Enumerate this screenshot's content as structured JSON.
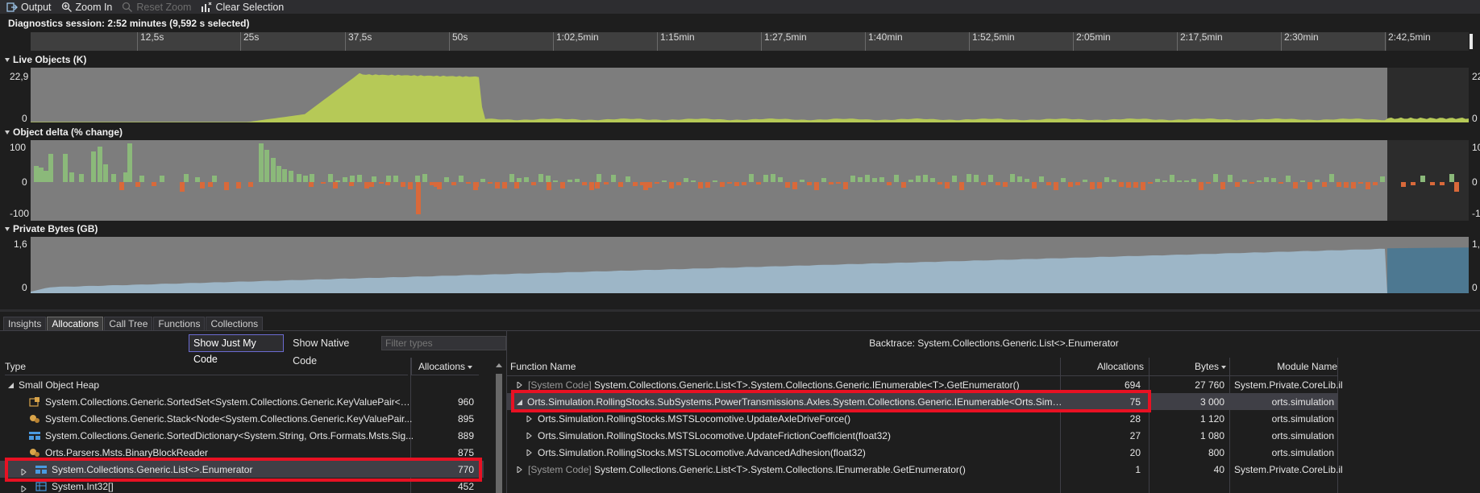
{
  "toolbar": {
    "output": "Output",
    "zoom_in": "Zoom In",
    "reset_zoom": "Reset Zoom",
    "clear_selection": "Clear Selection"
  },
  "session": {
    "label": "Diagnostics session:",
    "value": "2:52 minutes (9,592 s selected)"
  },
  "ruler": {
    "ticks": [
      "12,5s",
      "25s",
      "37,5s",
      "50s",
      "1:02,5min",
      "1:15min",
      "1:27,5min",
      "1:40min",
      "1:52,5min",
      "2:05min",
      "2:17,5min",
      "2:30min",
      "2:42,5min"
    ]
  },
  "graphs": {
    "live_objects": {
      "title": "Live Objects (K)",
      "max": "22,9",
      "min": "0",
      "right_max": "22",
      "right_min": "0"
    },
    "object_delta": {
      "title": "Object delta (% change)",
      "max": "100",
      "mid": "0",
      "min": "-100",
      "right_max": "10",
      "right_mid": "0",
      "right_min": "-1"
    },
    "private_bytes": {
      "title": "Private Bytes (GB)",
      "max": "1,6",
      "min": "0",
      "right_max": "1,",
      "right_min": "0"
    }
  },
  "colors": {
    "live": "#b6c957",
    "delta_pos": "#8bb97a",
    "delta_neg": "#d9693a",
    "bytes": "#9db6c7",
    "bytes_sel": "#4d7891",
    "highlight": "#e81123"
  },
  "tabs": [
    "Insights",
    "Allocations",
    "Call Tree",
    "Functions",
    "Collections"
  ],
  "left": {
    "show_just_my_code": "Show Just My Code",
    "show_native_code": "Show Native Code",
    "filter_placeholder": "Filter types",
    "col_type": "Type",
    "col_allocations": "Allocations",
    "group": "Small Object Heap",
    "rows": [
      {
        "name": "System.Collections.Generic.SortedSet<System.Collections.Generic.KeyValuePair<Sy...",
        "value": "960",
        "icon": "class-lock-icon"
      },
      {
        "name": "System.Collections.Generic.Stack<Node<System.Collections.Generic.KeyValuePair...",
        "value": "895",
        "icon": "class-gear-icon"
      },
      {
        "name": "System.Collections.Generic.SortedDictionary<System.String, Orts.Formats.Msts.Sig...",
        "value": "889",
        "icon": "struct-icon"
      },
      {
        "name": "Orts.Parsers.Msts.BinaryBlockReader",
        "value": "875",
        "icon": "class-gear-icon"
      },
      {
        "name": "System.Collections.Generic.List<>.Enumerator",
        "value": "770",
        "icon": "struct-icon"
      },
      {
        "name": "System.Int32[]",
        "value": "452",
        "icon": "array-icon"
      }
    ]
  },
  "right": {
    "backtrace_title": "Backtrace: System.Collections.Generic.List<>.Enumerator",
    "col_function": "Function Name",
    "col_allocations": "Allocations",
    "col_bytes": "Bytes",
    "col_module": "Module Name",
    "rows": [
      {
        "prefix": "[System Code]",
        "name": "System.Collections.Generic.List<T>.System.Collections.Generic.IEnumerable<T>.GetEnumerator()",
        "alloc": "694",
        "bytes": "27 760",
        "module": "System.Private.CoreLib.il",
        "indent": 0,
        "expanded": false
      },
      {
        "prefix": "",
        "name": "Orts.Simulation.RollingStocks.SubSystems.PowerTransmissions.Axles.System.Collections.Generic.IEnumerable<Orts.Simulati...",
        "alloc": "75",
        "bytes": "3 000",
        "module": "orts.simulation",
        "indent": 0,
        "expanded": true
      },
      {
        "prefix": "",
        "name": "Orts.Simulation.RollingStocks.MSTSLocomotive.UpdateAxleDriveForce()",
        "alloc": "28",
        "bytes": "1 120",
        "module": "orts.simulation",
        "indent": 1,
        "expanded": false
      },
      {
        "prefix": "",
        "name": "Orts.Simulation.RollingStocks.MSTSLocomotive.UpdateFrictionCoefficient(float32)",
        "alloc": "27",
        "bytes": "1 080",
        "module": "orts.simulation",
        "indent": 1,
        "expanded": false
      },
      {
        "prefix": "",
        "name": "Orts.Simulation.RollingStocks.MSTSLocomotive.AdvancedAdhesion(float32)",
        "alloc": "20",
        "bytes": "800",
        "module": "orts.simulation",
        "indent": 1,
        "expanded": false
      },
      {
        "prefix": "[System Code]",
        "name": "System.Collections.Generic.List<T>.System.Collections.IEnumerable.GetEnumerator()",
        "alloc": "1",
        "bytes": "40",
        "module": "System.Private.CoreLib.il",
        "indent": 0,
        "expanded": false
      }
    ]
  }
}
